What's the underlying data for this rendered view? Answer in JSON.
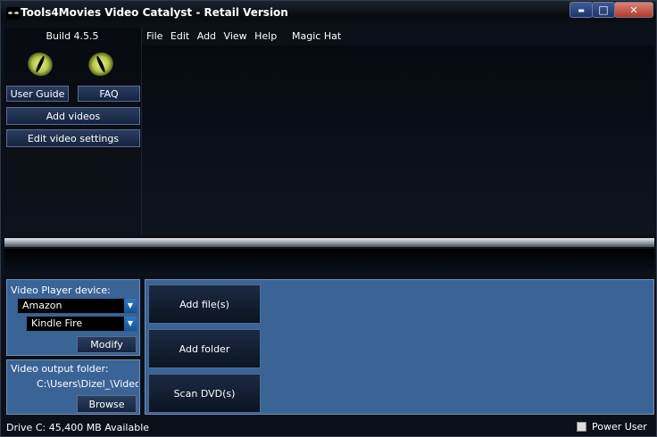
{
  "window": {
    "title": "Tools4Movies Video Catalyst - Retail Version",
    "minimize_glyph": "▬",
    "maximize_glyph": "□",
    "close_glyph": "✕"
  },
  "left": {
    "build": "Build 4.5.5",
    "user_guide": "User Guide",
    "faq": "FAQ",
    "add_videos": "Add videos",
    "edit_video_settings": "Edit video settings"
  },
  "menu": {
    "items": [
      "File",
      "Edit",
      "Add",
      "View",
      "Help"
    ],
    "magic_hat": "Magic Hat"
  },
  "device": {
    "label": "Video Player device:",
    "brand": "Amazon",
    "model": "Kindle Fire",
    "modify": "Modify"
  },
  "output": {
    "label": "Video output folder:",
    "path": "C:\\Users\\Dizel_\\Videos\\",
    "browse": "Browse"
  },
  "actions": {
    "add_files": "Add file(s)",
    "add_folder": "Add folder",
    "scan_dvd": "Scan DVD(s)"
  },
  "status": {
    "drive": "Drive C: 45,400 MB Available",
    "power_user": "Power User",
    "power_user_checked": false
  },
  "colors": {
    "panel_blue": "#3a6496",
    "dropdown_arrow": "#2d79c6",
    "close_red": "#b3392a"
  }
}
